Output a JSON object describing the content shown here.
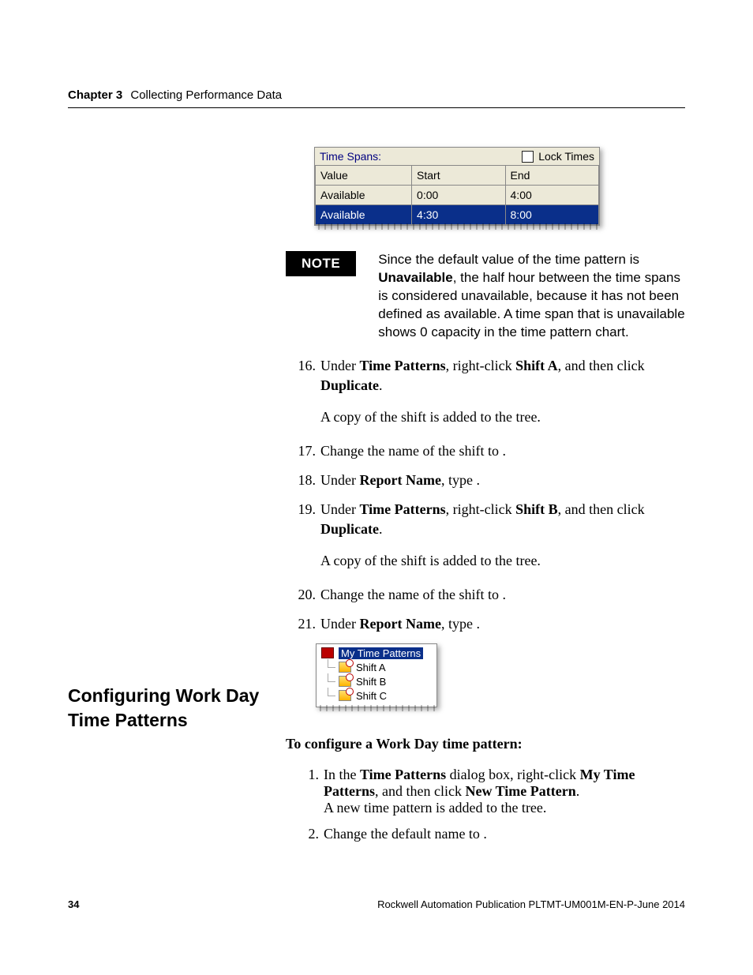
{
  "header": {
    "chapter": "Chapter 3",
    "title": "Collecting Performance Data"
  },
  "ui_timespans": {
    "label": "Time Spans:",
    "lock": "Lock Times",
    "cols": {
      "value": "Value",
      "start": "Start",
      "end": "End"
    },
    "rows": [
      {
        "value": "Available",
        "start": "0:00",
        "end": "4:00",
        "selected": false
      },
      {
        "value": "Available",
        "start": "4:30",
        "end": "8:00",
        "selected": true
      }
    ]
  },
  "note": {
    "badge": "NOTE",
    "text_pre": "Since the default value of the time pattern is ",
    "text_bold": "Unavailable",
    "text_post": ", the half hour between the time spans is considered unavailable, because it has not been defined as available. A time span that is unavailable shows 0 capacity in the time pattern chart."
  },
  "steps_a": {
    "s16": {
      "num": "16.",
      "text_pre": "Under ",
      "b1": "Time Patterns",
      "text_mid": ", right-click ",
      "b2": "Shift A",
      "text_post": ", and then click ",
      "b3": "Duplicate",
      "tail": ".",
      "sub": "A copy of the shift is added to the tree."
    },
    "s17": {
      "num": "17.",
      "text": "Change the name of the shift to                   ."
    },
    "s18": {
      "num": "18.",
      "text_pre": "Under ",
      "b1": "Report Name",
      "text_post": ", type                    ."
    },
    "s19": {
      "num": "19.",
      "text_pre": "Under ",
      "b1": "Time Patterns",
      "text_mid": ", right-click ",
      "b2": "Shift B",
      "text_post": ", and then click ",
      "b3": "Duplicate",
      "tail": ".",
      "sub": "A copy of the shift is added to the tree."
    },
    "s20": {
      "num": "20.",
      "text": "Change the name of the shift to                   ."
    },
    "s21": {
      "num": "21.",
      "text_pre": "Under ",
      "b1": "Report Name",
      "text_post": ", type                    ."
    }
  },
  "tree": {
    "root": "My Time Patterns",
    "items": [
      "Shift A",
      "Shift B",
      "Shift C"
    ]
  },
  "left_heading": "Configuring Work Day Time Patterns",
  "section_b": {
    "lead": "To configure a Work Day time pattern:",
    "s1": {
      "num": "1.",
      "text_pre": "In the ",
      "b1": "Time Patterns",
      "text_mid": " dialog box, right-click ",
      "b2": "My Time Patterns",
      "text_mid2": ", and then click ",
      "b3": "New Time Pattern",
      "tail": ".",
      "sub": "A new time pattern is added to the tree."
    },
    "s2": {
      "num": "2.",
      "text": "Change the default name to                    ."
    }
  },
  "footer": {
    "page": "34",
    "pub": "Rockwell Automation Publication PLTMT-UM001M-EN-P-June 2014"
  }
}
